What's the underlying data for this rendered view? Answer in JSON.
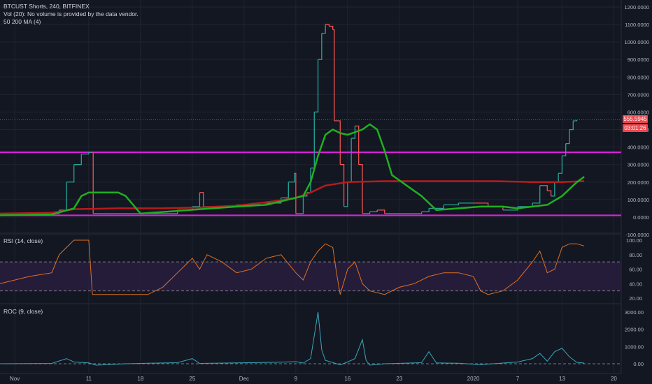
{
  "header": {
    "title": "BTCUST Shorts, 240, BITFINEX",
    "vol_note": "Vol (20): No volume is provided by the data vendor.",
    "ma_label": "50 200 MA (4)"
  },
  "rsi_label": "RSI (14, close)",
  "roc_label": "ROC (9, close)",
  "price_tag": {
    "value": "555.5945",
    "countdown": "03:01:26"
  },
  "colors": {
    "background": "#131722",
    "grid": "#1f2433",
    "candle_up": "#26a69a",
    "candle_down": "#ef5350",
    "ma_short": "#20b020",
    "ma_long": "#b71c1c",
    "horizontal_lines": "#e020e0",
    "rsi_line": "#e07020",
    "rsi_band": "#2b1e40",
    "roc_line": "#3aa6b9",
    "axis_text": "#b2b5be"
  },
  "chart_data": [
    {
      "type": "line",
      "title": "BTCUST Shorts, 240, BITFINEX",
      "x_tick_labels": [
        "Nov",
        "11",
        "18",
        "25",
        "Dec",
        "9",
        "16",
        "23",
        "2020",
        "7",
        "13",
        "20"
      ],
      "y_tick_labels": [
        "1200.0000",
        "1100.0000",
        "1000.0000",
        "900.0000",
        "800.0000",
        "700.0000",
        "600.0000",
        "500.0000",
        "400.0000",
        "300.0000",
        "200.0000",
        "100.0000",
        "0.0000",
        "-100.0000"
      ],
      "ylim": [
        -100,
        1200
      ],
      "x_range_days": [
        -2,
        82
      ],
      "x_tick_days": [
        0,
        10,
        17,
        24,
        31,
        38,
        45,
        52,
        62,
        68,
        74,
        81
      ],
      "horizontal_lines": [
        370,
        10
      ],
      "last_price": 555.5945,
      "series": [
        {
          "kind": "price",
          "points": [
            [
              -2,
              20
            ],
            [
              4,
              20
            ],
            [
              6,
              40
            ],
            [
              7,
              200
            ],
            [
              8,
              300
            ],
            [
              9,
              360
            ],
            [
              10,
              370
            ],
            [
              10.5,
              370
            ],
            [
              10.6,
              20
            ],
            [
              18,
              20
            ],
            [
              22,
              40
            ],
            [
              24,
              60
            ],
            [
              25,
              140
            ],
            [
              25.5,
              60
            ],
            [
              30,
              70
            ],
            [
              33,
              80
            ],
            [
              36,
              110
            ],
            [
              37,
              200
            ],
            [
              37.8,
              250
            ],
            [
              38,
              20
            ],
            [
              39,
              120
            ],
            [
              39.5,
              140
            ],
            [
              40,
              280
            ],
            [
              40.5,
              600
            ],
            [
              41,
              900
            ],
            [
              41.5,
              1050
            ],
            [
              42,
              1100
            ],
            [
              42.5,
              1090
            ],
            [
              43,
              1070
            ],
            [
              43.2,
              550
            ],
            [
              44,
              300
            ],
            [
              44.5,
              60
            ],
            [
              45,
              200
            ],
            [
              45.5,
              450
            ],
            [
              46,
              520
            ],
            [
              46.5,
              300
            ],
            [
              47,
              20
            ],
            [
              48,
              30
            ],
            [
              49,
              40
            ],
            [
              50,
              20
            ],
            [
              52,
              20
            ],
            [
              54,
              20
            ],
            [
              55,
              30
            ],
            [
              56,
              50
            ],
            [
              58,
              70
            ],
            [
              60,
              80
            ],
            [
              62,
              80
            ],
            [
              64,
              60
            ],
            [
              66,
              40
            ],
            [
              68,
              60
            ],
            [
              70,
              80
            ],
            [
              71,
              180
            ],
            [
              72,
              150
            ],
            [
              72.5,
              120
            ],
            [
              73,
              200
            ],
            [
              73.5,
              250
            ],
            [
              74,
              350
            ],
            [
              74.5,
              420
            ],
            [
              75,
              500
            ],
            [
              75.5,
              550
            ],
            [
              76,
              555
            ]
          ]
        },
        {
          "name": "50",
          "kind": "ma50",
          "points": [
            [
              -2,
              10
            ],
            [
              5,
              15
            ],
            [
              8,
              50
            ],
            [
              9,
              120
            ],
            [
              10,
              140
            ],
            [
              14,
              140
            ],
            [
              15,
              120
            ],
            [
              17,
              20
            ],
            [
              30,
              60
            ],
            [
              34,
              70
            ],
            [
              37,
              100
            ],
            [
              39,
              120
            ],
            [
              40,
              200
            ],
            [
              41,
              350
            ],
            [
              42,
              470
            ],
            [
              43,
              500
            ],
            [
              44,
              480
            ],
            [
              45,
              470
            ],
            [
              47,
              500
            ],
            [
              48,
              530
            ],
            [
              49,
              500
            ],
            [
              50,
              380
            ],
            [
              51,
              240
            ],
            [
              53,
              180
            ],
            [
              55,
              120
            ],
            [
              57,
              40
            ],
            [
              60,
              50
            ],
            [
              63,
              60
            ],
            [
              66,
              60
            ],
            [
              68,
              50
            ],
            [
              70,
              60
            ],
            [
              72,
              70
            ],
            [
              74,
              120
            ],
            [
              76,
              200
            ],
            [
              77,
              230
            ]
          ]
        },
        {
          "name": "200",
          "kind": "ma200",
          "points": [
            [
              -2,
              20
            ],
            [
              5,
              25
            ],
            [
              8,
              45
            ],
            [
              14,
              50
            ],
            [
              20,
              50
            ],
            [
              25,
              55
            ],
            [
              30,
              65
            ],
            [
              35,
              90
            ],
            [
              38,
              110
            ],
            [
              40,
              140
            ],
            [
              42,
              180
            ],
            [
              45,
              200
            ],
            [
              50,
              205
            ],
            [
              55,
              205
            ],
            [
              60,
              205
            ],
            [
              65,
              205
            ],
            [
              70,
              200
            ],
            [
              74,
              200
            ],
            [
              77,
              205
            ]
          ]
        }
      ]
    },
    {
      "type": "line",
      "title": "RSI (14, close)",
      "y_tick_labels": [
        "100.00",
        "80.00",
        "60.00",
        "40.00",
        "20.00"
      ],
      "ylim": [
        20,
        100
      ],
      "band": [
        30,
        70
      ],
      "series": [
        {
          "kind": "rsi",
          "points": [
            [
              -2,
              40
            ],
            [
              2,
              50
            ],
            [
              5,
              55
            ],
            [
              6,
              80
            ],
            [
              7,
              90
            ],
            [
              8,
              100
            ],
            [
              10,
              100
            ],
            [
              10.5,
              25
            ],
            [
              12,
              25
            ],
            [
              15,
              25
            ],
            [
              18,
              25
            ],
            [
              20,
              35
            ],
            [
              22,
              55
            ],
            [
              24,
              75
            ],
            [
              25,
              60
            ],
            [
              26,
              80
            ],
            [
              28,
              70
            ],
            [
              30,
              55
            ],
            [
              32,
              60
            ],
            [
              34,
              75
            ],
            [
              36,
              80
            ],
            [
              38,
              55
            ],
            [
              39,
              45
            ],
            [
              40,
              70
            ],
            [
              41,
              85
            ],
            [
              42,
              95
            ],
            [
              43,
              90
            ],
            [
              43.5,
              55
            ],
            [
              44,
              25
            ],
            [
              45,
              60
            ],
            [
              46,
              70
            ],
            [
              47,
              40
            ],
            [
              48,
              30
            ],
            [
              50,
              25
            ],
            [
              52,
              35
            ],
            [
              54,
              40
            ],
            [
              56,
              50
            ],
            [
              58,
              55
            ],
            [
              60,
              55
            ],
            [
              62,
              50
            ],
            [
              63,
              30
            ],
            [
              64,
              25
            ],
            [
              66,
              30
            ],
            [
              68,
              45
            ],
            [
              70,
              70
            ],
            [
              71,
              85
            ],
            [
              72,
              55
            ],
            [
              73,
              60
            ],
            [
              74,
              90
            ],
            [
              75,
              95
            ],
            [
              76,
              95
            ],
            [
              77,
              92
            ]
          ]
        }
      ]
    },
    {
      "type": "line",
      "title": "ROC (9, close)",
      "y_tick_labels": [
        "3000.00",
        "2000.00",
        "1000.00",
        "0.00"
      ],
      "ylim": [
        -300,
        3300
      ],
      "series": [
        {
          "kind": "roc",
          "points": [
            [
              -2,
              0
            ],
            [
              5,
              20
            ],
            [
              7,
              300
            ],
            [
              8,
              100
            ],
            [
              10,
              50
            ],
            [
              11,
              -80
            ],
            [
              15,
              0
            ],
            [
              18,
              30
            ],
            [
              22,
              60
            ],
            [
              24,
              300
            ],
            [
              25,
              20
            ],
            [
              30,
              50
            ],
            [
              35,
              80
            ],
            [
              38,
              120
            ],
            [
              39,
              40
            ],
            [
              40,
              300
            ],
            [
              41,
              3000
            ],
            [
              41.5,
              800
            ],
            [
              42,
              200
            ],
            [
              44,
              -60
            ],
            [
              45,
              100
            ],
            [
              46,
              300
            ],
            [
              47,
              1400
            ],
            [
              47.5,
              200
            ],
            [
              48,
              -80
            ],
            [
              50,
              0
            ],
            [
              55,
              60
            ],
            [
              56,
              700
            ],
            [
              57,
              50
            ],
            [
              60,
              30
            ],
            [
              63,
              -50
            ],
            [
              66,
              40
            ],
            [
              68,
              100
            ],
            [
              70,
              300
            ],
            [
              71,
              600
            ],
            [
              72,
              150
            ],
            [
              73,
              700
            ],
            [
              74,
              900
            ],
            [
              75,
              400
            ],
            [
              76,
              80
            ],
            [
              77,
              40
            ]
          ]
        }
      ]
    }
  ]
}
